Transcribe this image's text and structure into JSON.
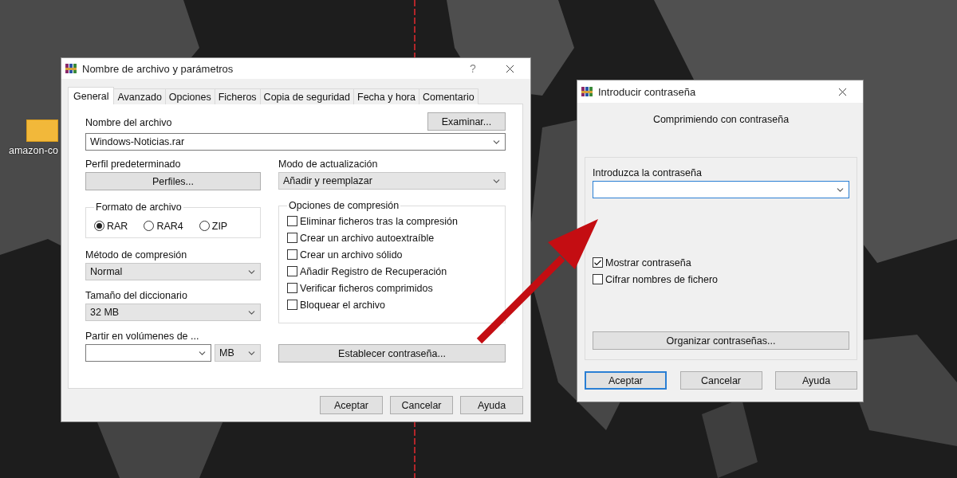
{
  "desktop_icon": {
    "label": "amazon-co"
  },
  "archive_dialog": {
    "title": "Nombre de archivo y parámetros",
    "help_button": "?",
    "tabs": [
      {
        "label": "General",
        "selected": true
      },
      {
        "label": "Avanzado",
        "selected": false
      },
      {
        "label": "Opciones",
        "selected": false
      },
      {
        "label": "Ficheros",
        "selected": false
      },
      {
        "label": "Copia de seguridad",
        "selected": false
      },
      {
        "label": "Fecha y hora",
        "selected": false
      },
      {
        "label": "Comentario",
        "selected": false
      }
    ],
    "file_name": {
      "label": "Nombre del archivo",
      "value": "Windows-Noticias.rar",
      "button": "Examinar..."
    },
    "default_profile": {
      "label": "Perfil predeterminado",
      "button": "Perfiles..."
    },
    "update_mode": {
      "label": "Modo de actualización",
      "value": "Añadir y reemplazar"
    },
    "archive_format": {
      "label": "Formato de archivo",
      "options": [
        {
          "label": "RAR",
          "selected": true
        },
        {
          "label": "RAR4",
          "selected": false
        },
        {
          "label": "ZIP",
          "selected": false
        }
      ]
    },
    "compression_options": {
      "label": "Opciones de compresión",
      "items": [
        {
          "label": "Eliminar ficheros tras la compresión",
          "checked": false
        },
        {
          "label": "Crear un archivo autoextraíble",
          "checked": false
        },
        {
          "label": "Crear un archivo sólido",
          "checked": false
        },
        {
          "label": "Añadir Registro de Recuperación",
          "checked": false
        },
        {
          "label": "Verificar ficheros comprimidos",
          "checked": false
        },
        {
          "label": "Bloquear el archivo",
          "checked": false
        }
      ]
    },
    "compression_method": {
      "label": "Método de compresión",
      "value": "Normal"
    },
    "dictionary_size": {
      "label": "Tamaño del diccionario",
      "value": "32 MB"
    },
    "split_volumes": {
      "label": "Partir en volúmenes de ...",
      "unit": "MB"
    },
    "set_password_button": "Establecer contraseña...",
    "buttons": [
      {
        "label": "Aceptar",
        "focused": false
      },
      {
        "label": "Cancelar",
        "focused": false
      },
      {
        "label": "Ayuda",
        "focused": false
      }
    ]
  },
  "password_dialog": {
    "title": "Introducir contraseña",
    "heading": "Comprimiendo con contraseña",
    "password_field": {
      "label": "Introduzca la contraseña",
      "focused": true
    },
    "options": [
      {
        "label": "Mostrar contraseña",
        "checked": true
      },
      {
        "label": "Cifrar nombres de fichero",
        "checked": false
      }
    ],
    "manage_button": "Organizar contraseñas...",
    "buttons": [
      {
        "label": "Aceptar",
        "focused": true
      },
      {
        "label": "Cancelar",
        "focused": false
      },
      {
        "label": "Ayuda",
        "focused": false
      }
    ]
  }
}
